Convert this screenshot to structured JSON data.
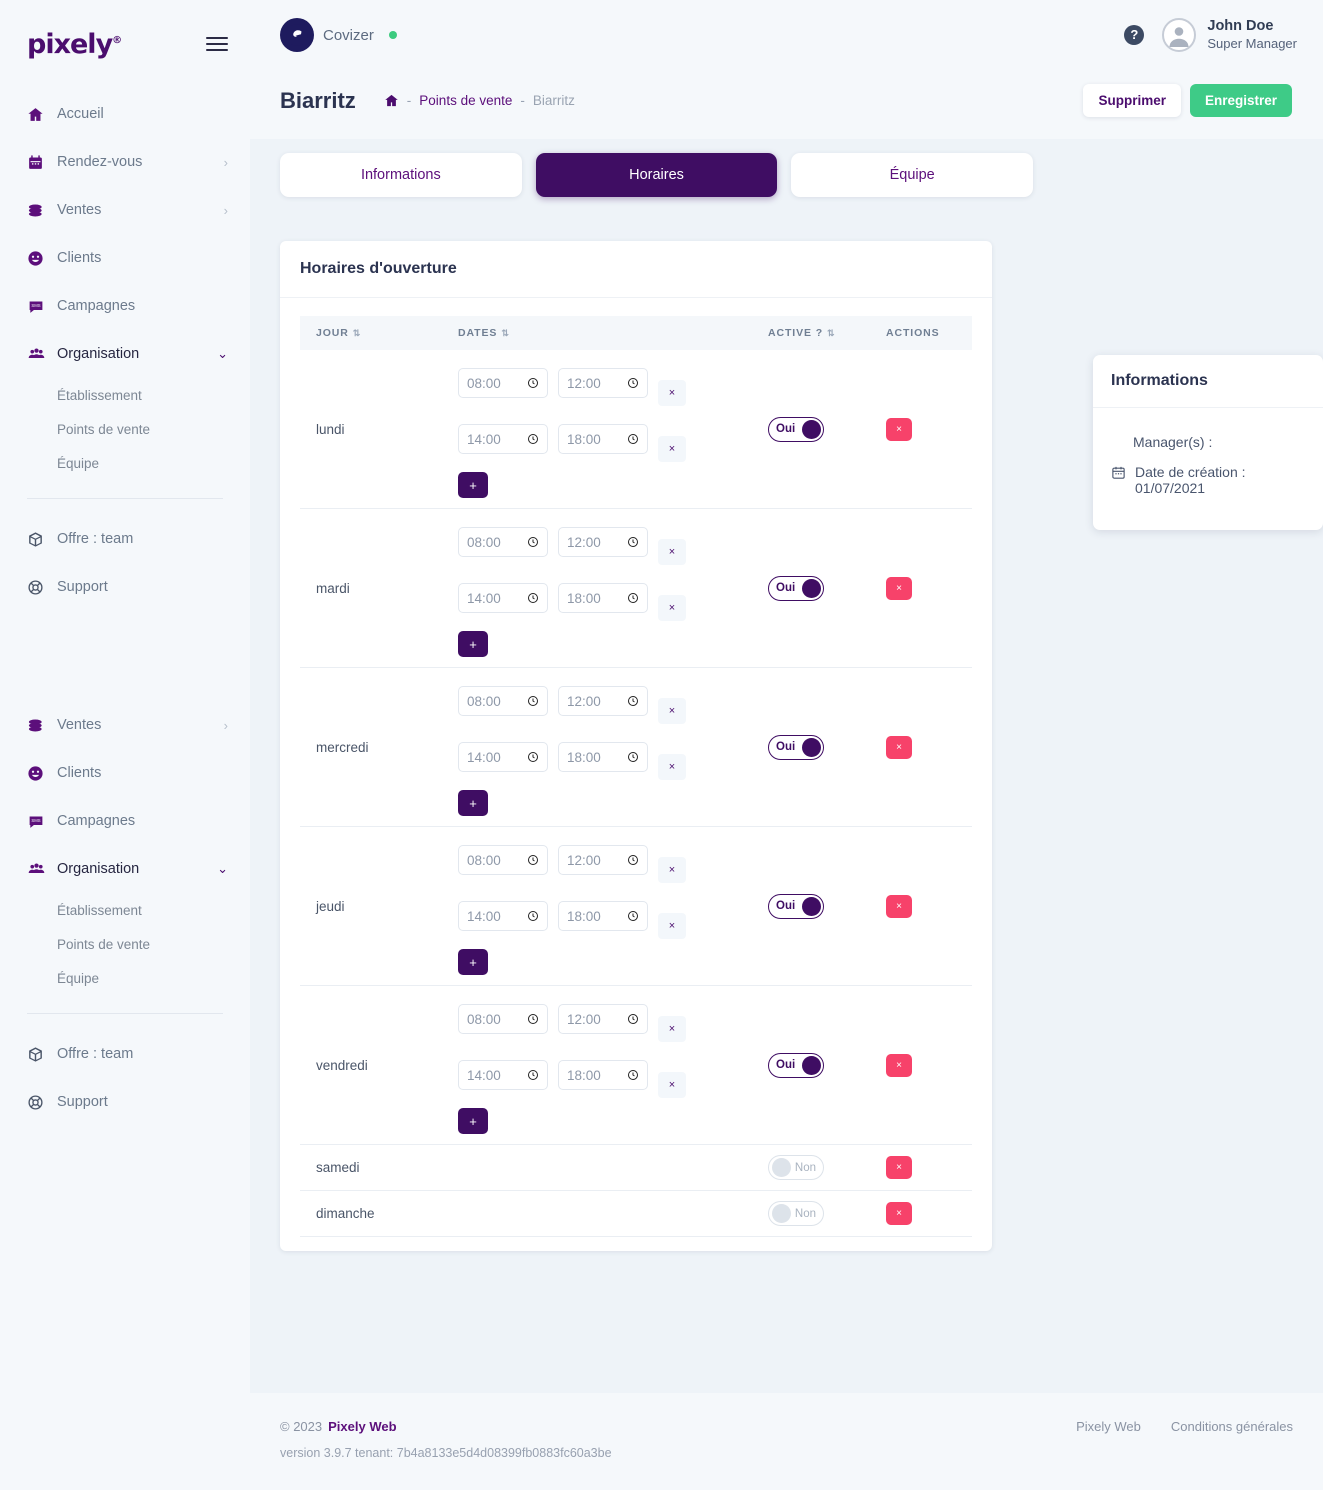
{
  "brand": {
    "logo_text": "pixely",
    "burger_icon": "hamburger-icon"
  },
  "sidebar": {
    "primary": [
      {
        "label": "Accueil",
        "icon": "home-icon",
        "chevron": "",
        "active": false
      },
      {
        "label": "Rendez-vous",
        "icon": "calendar-icon",
        "chevron": "›",
        "active": false
      },
      {
        "label": "Ventes",
        "icon": "coins-icon",
        "chevron": "›",
        "active": false
      },
      {
        "label": "Clients",
        "icon": "smiley-icon",
        "chevron": "",
        "active": false
      },
      {
        "label": "Campagnes",
        "icon": "sms-icon",
        "chevron": "",
        "active": false
      },
      {
        "label": "Organisation",
        "icon": "people-icon",
        "chevron": "⌄",
        "active": true
      }
    ],
    "sub_items": [
      "Établissement",
      "Points de vente",
      "Équipe"
    ],
    "bottom": [
      {
        "label": "Offre : team",
        "icon": "box-icon"
      },
      {
        "label": "Support",
        "icon": "lifebuoy-icon"
      }
    ],
    "secondary": [
      {
        "label": "Ventes",
        "icon": "coins-icon",
        "chevron": "›",
        "active": false
      },
      {
        "label": "Clients",
        "icon": "smiley-icon",
        "chevron": "",
        "active": false
      },
      {
        "label": "Campagnes",
        "icon": "sms-icon",
        "chevron": "",
        "active": false
      },
      {
        "label": "Organisation",
        "icon": "people-icon",
        "chevron": "⌄",
        "active": true
      }
    ]
  },
  "topbar": {
    "tenant_name": "Covizer",
    "status_color": "#3ccb7f",
    "help_label": "?",
    "user_name": "John Doe",
    "user_role": "Super Manager"
  },
  "page": {
    "title": "Biarritz",
    "breadcrumb": {
      "home_icon": "home-icon",
      "sep": "-",
      "link": "Points de vente",
      "current": "Biarritz"
    },
    "delete_label": "Supprimer",
    "save_label": "Enregistrer",
    "save_color": "#3ecb87"
  },
  "tabs": [
    {
      "label": "Informations",
      "selected": false
    },
    {
      "label": "Horaires",
      "selected": true
    },
    {
      "label": "Équipe",
      "selected": false
    }
  ],
  "card": {
    "title": "Horaires d'ouverture",
    "columns": [
      "Jour",
      "Dates",
      "",
      "Active ?",
      "Actions"
    ],
    "rows": [
      {
        "day": "lundi",
        "slots": [
          [
            "08:00",
            "12:00"
          ],
          [
            "14:00",
            "18:00"
          ]
        ],
        "active": true,
        "active_label": "Oui",
        "has_add": true
      },
      {
        "day": "mardi",
        "slots": [
          [
            "08:00",
            "12:00"
          ],
          [
            "14:00",
            "18:00"
          ]
        ],
        "active": true,
        "active_label": "Oui",
        "has_add": true
      },
      {
        "day": "mercredi",
        "slots": [
          [
            "08:00",
            "12:00"
          ],
          [
            "14:00",
            "18:00"
          ]
        ],
        "active": true,
        "active_label": "Oui",
        "has_add": true
      },
      {
        "day": "jeudi",
        "slots": [
          [
            "08:00",
            "12:00"
          ],
          [
            "14:00",
            "18:00"
          ]
        ],
        "active": true,
        "active_label": "Oui",
        "has_add": true
      },
      {
        "day": "vendredi",
        "slots": [
          [
            "08:00",
            "12:00"
          ],
          [
            "14:00",
            "18:00"
          ]
        ],
        "active": true,
        "active_label": "Oui",
        "has_add": true
      },
      {
        "day": "samedi",
        "slots": [],
        "active": false,
        "active_label": "Non",
        "has_add": false
      },
      {
        "day": "dimanche",
        "slots": [],
        "active": false,
        "active_label": "Non",
        "has_add": false
      }
    ],
    "add_label": "+",
    "remove_slot_label": "×",
    "delete_row_label": "×",
    "clock_icon": "clock-icon"
  },
  "info_panel": {
    "title": "Informations",
    "managers_label": "Manager(s) :",
    "created_label": "Date de création :",
    "created_value": "01/07/2021",
    "calendar_icon": "calendar-icon"
  },
  "footer": {
    "copyright": "© 2023",
    "brand": "Pixely Web",
    "links": [
      "Pixely Web",
      "Conditions générales"
    ],
    "version": "version 3.9.7 tenant: 7b4a8133e5d4d08399fb0883fc60a3be"
  }
}
